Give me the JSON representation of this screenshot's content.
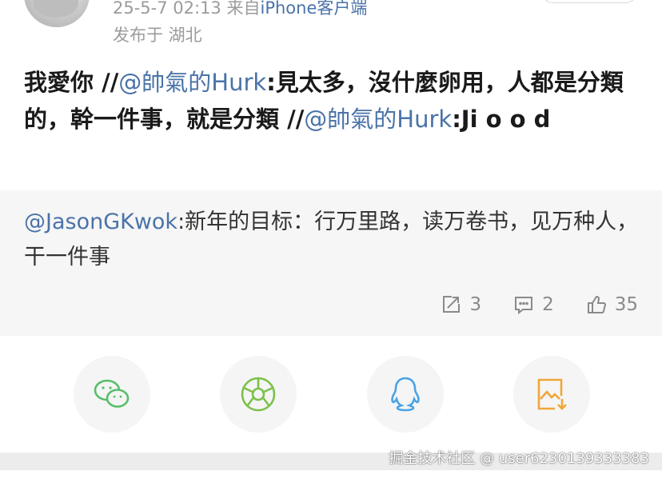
{
  "header": {
    "timestamp": "25-5-7 02:13",
    "source_prefix": "来自",
    "source": "iPhone客户端",
    "location": "发布于 湖北"
  },
  "post": {
    "t1": "我愛你 //",
    "m1": "@帥氣的Hurk",
    "t2": ":見太多，沒什麼卵用，人都是分類的，幹一件事，就是分類 //",
    "m2": "@帥氣的Hurk",
    "t3": ":Ji o o d"
  },
  "repost": {
    "mention": "@JasonGKwok",
    "text": ":新年的目标：行万里路，读万卷书，见万种人，干一件事"
  },
  "actions": {
    "repost_count": "3",
    "comment_count": "2",
    "like_count": "35"
  },
  "share": {
    "icons": [
      "wechat-icon",
      "moments-icon",
      "qq-icon",
      "save-image-icon"
    ]
  },
  "watermark": "掘金技术社区 @ user6230139333383",
  "colors": {
    "link": "#4a73a8",
    "wechat": "#57be6a",
    "moments": "#7cc04b",
    "qq": "#4aa3e6",
    "save": "#f0a63a"
  }
}
